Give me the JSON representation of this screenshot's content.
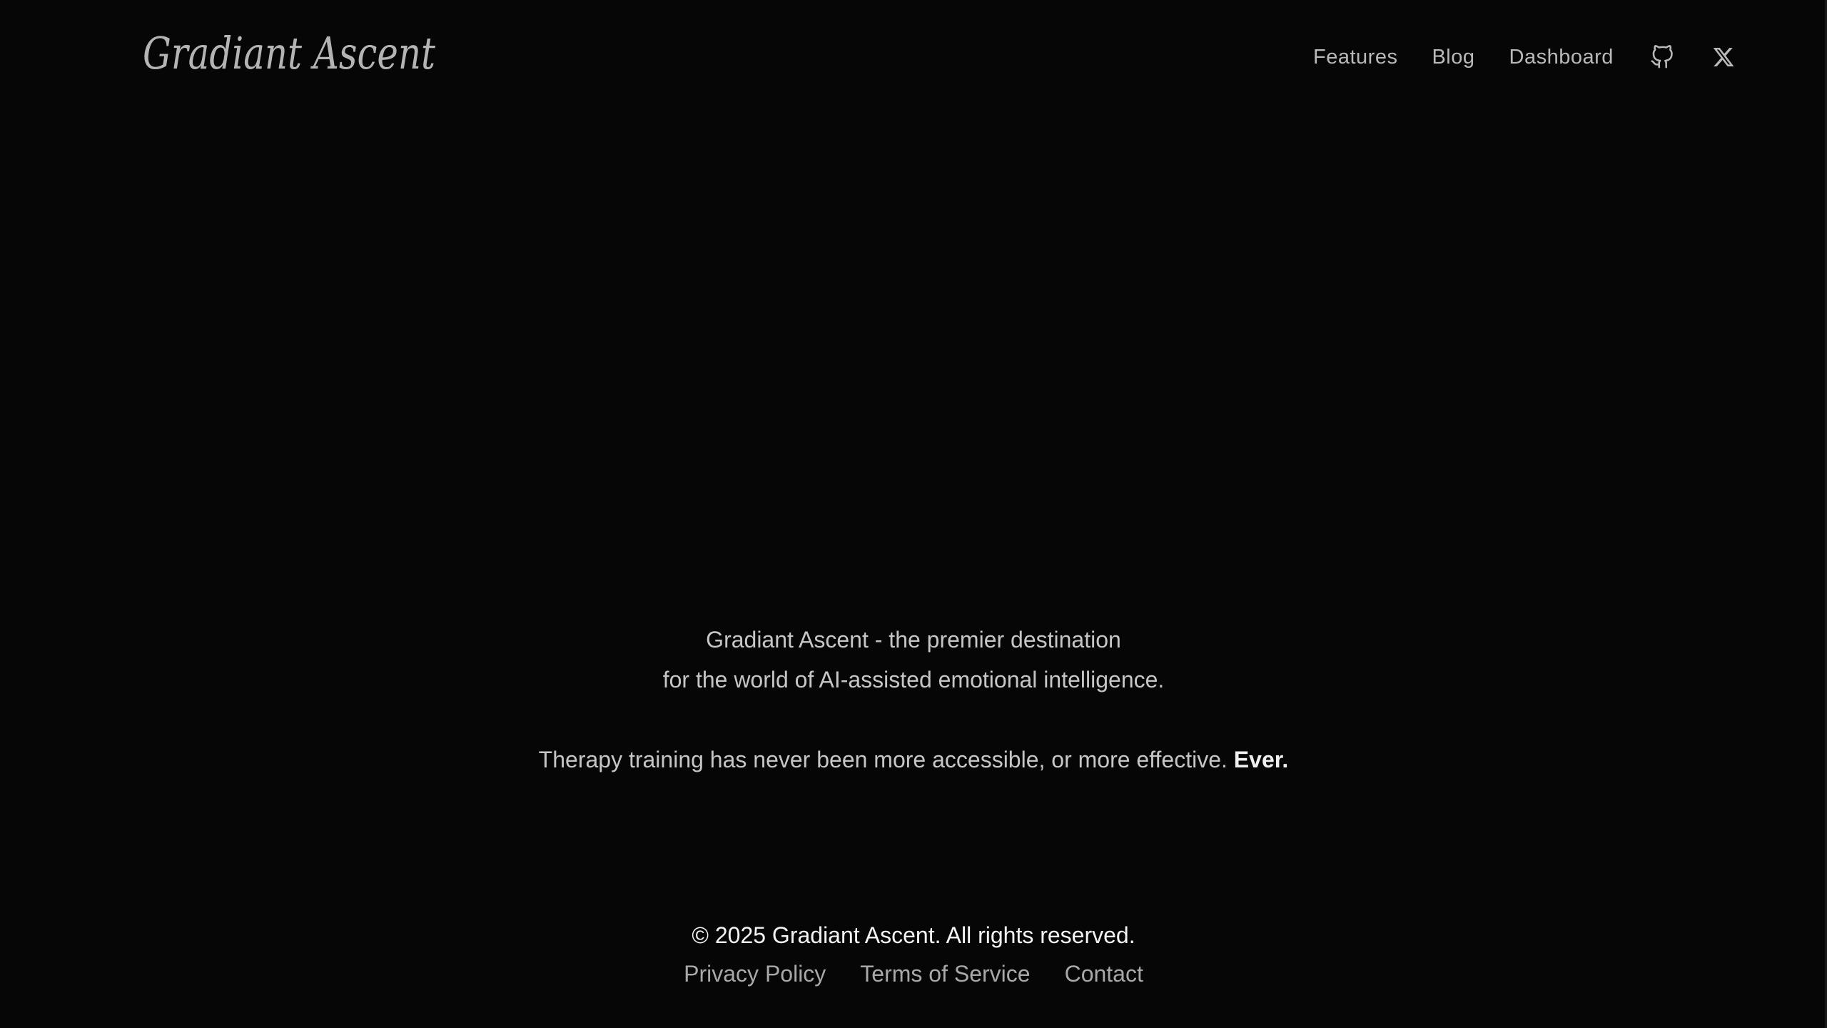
{
  "brand": {
    "logo_text": "Gradiant Ascent"
  },
  "nav": {
    "items": [
      {
        "label": "Features"
      },
      {
        "label": "Blog"
      },
      {
        "label": "Dashboard"
      }
    ],
    "icons": [
      "github-icon",
      "x-icon"
    ]
  },
  "hero": {
    "line1": "Gradiant Ascent - the premier destination",
    "line2": "for the world of AI-assisted emotional intelligence.",
    "tagline": "Therapy training has never been more accessible, or more effective.",
    "tagline_emphasis": "Ever."
  },
  "footer": {
    "copyright": "© 2025 Gradiant Ascent. All rights reserved.",
    "links": [
      {
        "label": "Privacy Policy"
      },
      {
        "label": "Terms of Service"
      },
      {
        "label": "Contact"
      }
    ]
  },
  "colors": {
    "background": "#060606",
    "nav_text": "#b9b9b9",
    "body_text": "#c6c6c6",
    "emphasis_text": "#f0f0f0",
    "footer_link": "#a8a8a8",
    "logo": "#b4b4b4"
  }
}
